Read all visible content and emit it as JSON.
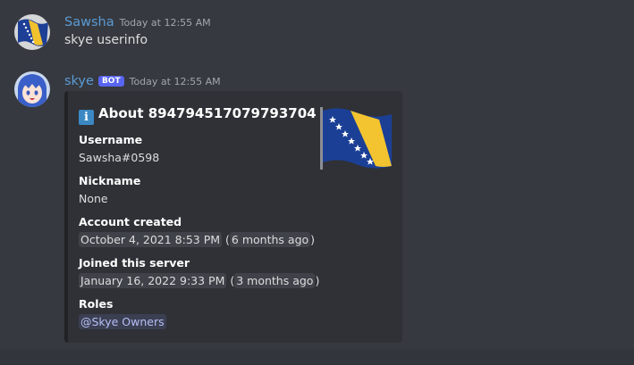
{
  "messages": [
    {
      "author": "Sawsha",
      "author_color": "#5b9bd5",
      "timestamp": "Today at 12:55 AM",
      "content": "skye userinfo"
    },
    {
      "author": "skye",
      "author_color": "#5b9bd5",
      "bot_tag": "BOT",
      "timestamp": "Today at 12:55 AM",
      "embed": {
        "icon": "info-icon",
        "icon_glyph": "i",
        "title": "About 894794517079793704",
        "fields": [
          {
            "name": "Username",
            "value": "Sawsha#0598"
          },
          {
            "name": "Nickname",
            "value": "None"
          },
          {
            "name": "Account created",
            "timestamp": "October 4, 2021 8:53 PM",
            "relative": "6 months ago"
          },
          {
            "name": "Joined this server",
            "timestamp": "January 16, 2022 9:33 PM",
            "relative": "3 months ago"
          },
          {
            "name": "Roles",
            "mention": "@Skye Owners"
          }
        ],
        "thumbnail": "bosnia-flag-icon"
      }
    }
  ],
  "colors": {
    "background": "#36393f",
    "embed_background": "#2f3136",
    "bot_tag": "#5865f2",
    "mention_text": "#b6bef5"
  }
}
